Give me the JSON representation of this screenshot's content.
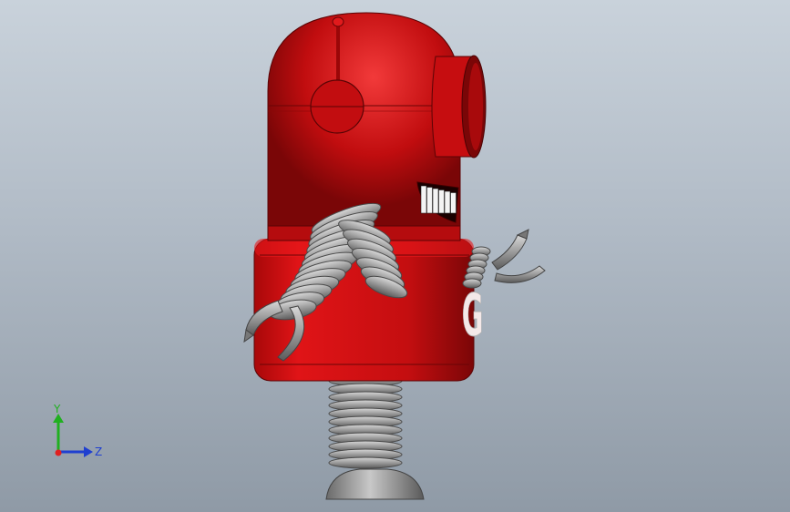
{
  "viewport": {
    "model": "robot",
    "body_color": "#d40d10",
    "metal_color": "#8c8c8c",
    "body_badge_text": "G"
  },
  "triad": {
    "y_label": "Y",
    "z_label": "Z",
    "y_color": "#20b020",
    "z_color": "#1f3fd0",
    "origin_color": "#e02020"
  }
}
